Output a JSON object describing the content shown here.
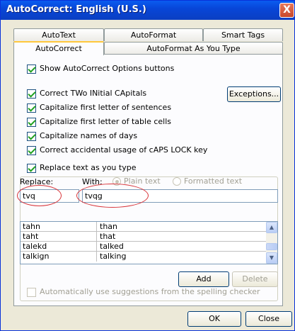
{
  "window": {
    "title": "AutoCorrect: English (U.S.)",
    "close_glyph": "X"
  },
  "tabs": {
    "row1": [
      "AutoText",
      "AutoFormat",
      "Smart Tags"
    ],
    "row2": [
      "AutoCorrect",
      "AutoFormat As You Type"
    ]
  },
  "options": {
    "show_buttons": "Show AutoCorrect Options buttons",
    "correct_two_initials": "Correct TWo INitial CApitals",
    "cap_first_sentence": "Capitalize first letter of sentences",
    "cap_first_table": "Capitalize first letter of table cells",
    "cap_names_days": "Capitalize names of days",
    "caps_lock": "Correct accidental usage of cAPS LOCK key",
    "replace_text": "Replace text as you type"
  },
  "exceptions_label": "Exceptions...",
  "replace_label": "Replace:",
  "with_label": "With:",
  "plain_text": "Plain text",
  "formatted_text": "Formatted text",
  "replace_value": "tvq",
  "with_value": "tvqg",
  "list": [
    {
      "from": "tahn",
      "to": "than"
    },
    {
      "from": "taht",
      "to": "that"
    },
    {
      "from": "talekd",
      "to": "talked"
    },
    {
      "from": "talkign",
      "to": "talking"
    }
  ],
  "add_label": "Add",
  "delete_label": "Delete",
  "suggestions_label": "Automatically use suggestions from the spelling checker",
  "ok_label": "OK",
  "close_label": "Close",
  "colors": {
    "title_blue": "#0846d8",
    "annotation_red": "#d9353a",
    "checkmark_green": "#21a121"
  }
}
